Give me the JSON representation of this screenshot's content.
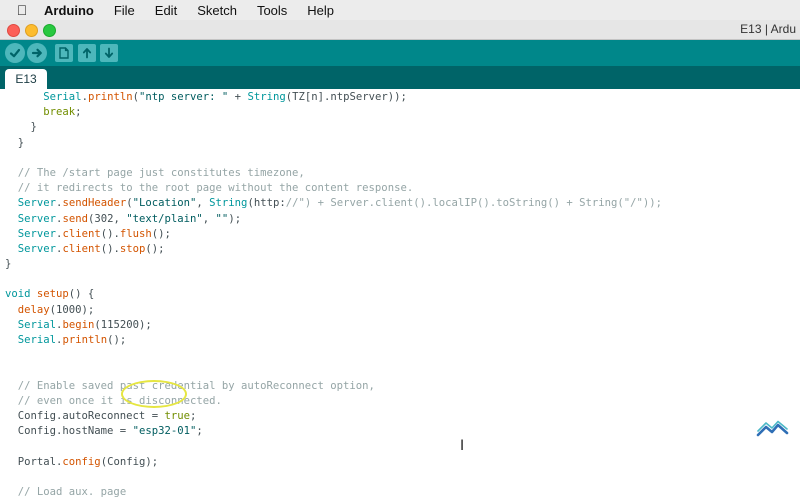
{
  "menubar": {
    "apple_icon": "apple-icon",
    "app_name": "Arduino",
    "items": [
      "File",
      "Edit",
      "Sketch",
      "Tools",
      "Help"
    ]
  },
  "window": {
    "title": "E13 | Ardu"
  },
  "toolbar": {
    "buttons": [
      "verify",
      "upload",
      "new",
      "open",
      "save"
    ],
    "color": "#00878a"
  },
  "tabs": [
    {
      "label": "E13"
    }
  ],
  "editor": {
    "lines": [
      "      Serial.println(\"ntp server: \" + String(TZ[n].ntpServer));",
      "      break;",
      "    }",
      "  }",
      "",
      "  // The /start page just constitutes timezone,",
      "  // it redirects to the root page without the content response.",
      "  Server.sendHeader(\"Location\", String(\"http://\") + Server.client().localIP().toString() + String(\"/\"));",
      "  Server.send(302, \"text/plain\", \"\");",
      "  Server.client().flush();",
      "  Server.client().stop();",
      "}",
      "",
      "void setup() {",
      "  delay(1000);",
      "  Serial.begin(115200);",
      "  Serial.println();",
      "",
      "",
      "  // Enable saved past credential by autoReconnect option,",
      "  // even once it is disconnected.",
      "  Config.autoReconnect = true;",
      "  Config.hostName = \"esp32-01\";",
      "",
      "  Portal.config(Config);",
      "",
      "  // Load aux. page"
    ]
  },
  "annotation": {
    "highlighted_value": "\"esp32-01\"",
    "ring_color": "#e6e641"
  },
  "watermark": {
    "icon": "brand-logo"
  }
}
